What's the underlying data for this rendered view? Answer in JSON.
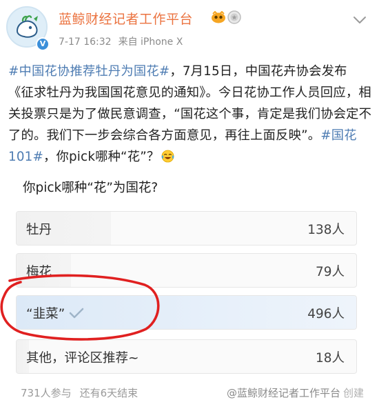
{
  "header": {
    "account_name": "蓝鲸财经记者工作平台",
    "time": "7-17 16:32",
    "source": "来自 iPhone X",
    "icons": [
      "avatar",
      "verified-badge-icon",
      "vip-crown-icon",
      "medal-icon",
      "chevron-down-icon"
    ]
  },
  "post": {
    "hashtag1": "#中国花协推荐牡丹为国花#",
    "text1": "，7月15日，中国花卉协会发布《征求牡丹为我国国花意见的通知》。今日花协工作人员回应，相关投票只是为了做民意调查，“国花这个事，肯定是我们协会定不了的。我们下一步会综合各方面意见，再往上面反映”。",
    "hashtag2": "#国花101#",
    "text2": "，你pick哪种“花”？",
    "emoji": "laughing-tears-emoji"
  },
  "poll": {
    "question": "你pick哪种“花”为国花?",
    "options": [
      {
        "label": "牡丹",
        "count": "138人",
        "votes": 138,
        "selected": false
      },
      {
        "label": "梅花",
        "count": "79人",
        "votes": 79,
        "selected": false
      },
      {
        "label": "“韭菜”",
        "count": "496人",
        "votes": 496,
        "selected": true
      },
      {
        "label": "其他，评论区推荐~",
        "count": "18人",
        "votes": 18,
        "selected": false
      }
    ],
    "participants": "731人参与",
    "remaining": "还有6天结束",
    "creator": "@蓝鲸财经记者工作平台",
    "creator_action": "创建"
  },
  "colors": {
    "name": "#eb7340",
    "link": "#4f7db3",
    "highlight_circle": "#e02020",
    "selected_fill": "#dce9f7",
    "check": "#9fb4c8"
  }
}
